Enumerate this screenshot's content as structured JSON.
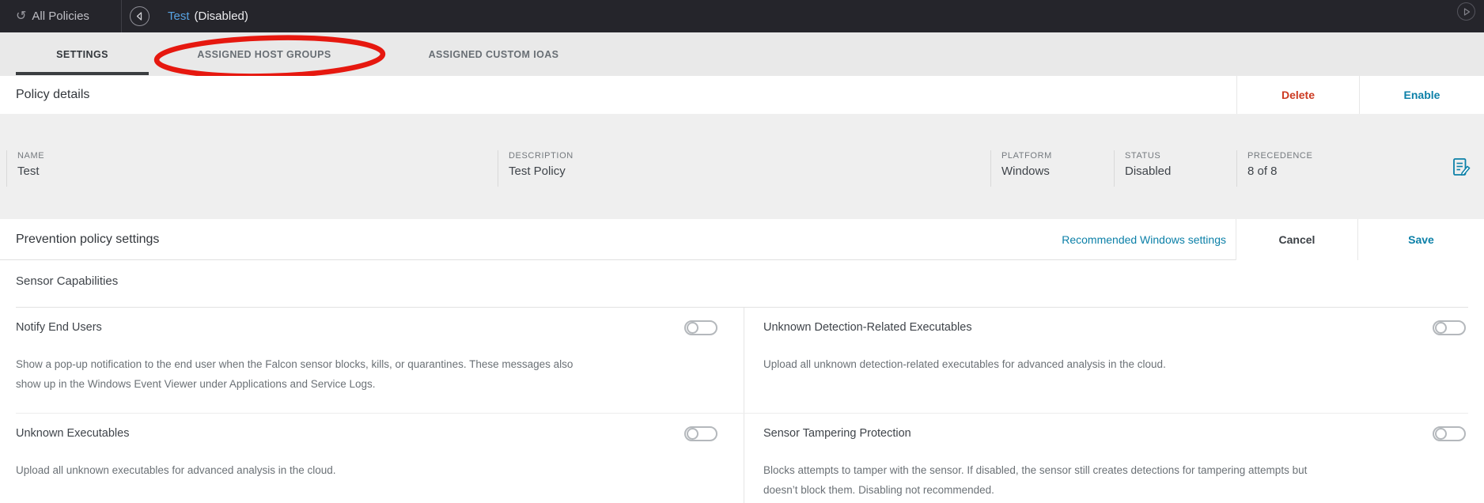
{
  "topbar": {
    "all_policies_label": "All Policies",
    "policy_name": "Test",
    "policy_state": "(Disabled)"
  },
  "tabs": [
    {
      "label": "SETTINGS",
      "active": true
    },
    {
      "label": "ASSIGNED HOST GROUPS",
      "active": false
    },
    {
      "label": "ASSIGNED CUSTOM IOAS",
      "active": false
    }
  ],
  "annotation": {
    "highlighted_tab": "ASSIGNED HOST GROUPS",
    "shape": "red-ellipse",
    "color": "#e6180f"
  },
  "policy_details": {
    "title": "Policy details",
    "delete_label": "Delete",
    "enable_label": "Enable",
    "fields": [
      {
        "label": "NAME",
        "value": "Test"
      },
      {
        "label": "DESCRIPTION",
        "value": "Test Policy"
      },
      {
        "label": "PLATFORM",
        "value": "Windows"
      },
      {
        "label": "STATUS",
        "value": "Disabled"
      },
      {
        "label": "PRECEDENCE",
        "value": "8 of 8"
      }
    ]
  },
  "prevention": {
    "title": "Prevention policy settings",
    "recommended_link": "Recommended Windows settings",
    "cancel_label": "Cancel",
    "save_label": "Save"
  },
  "sensor_capabilities": {
    "title": "Sensor Capabilities",
    "settings": [
      {
        "name": "Notify End Users",
        "description": "Show a pop-up notification to the end user when the Falcon sensor blocks, kills, or quarantines. These messages also show up in the Windows Event Viewer under Applications and Service Logs.",
        "enabled": false
      },
      {
        "name": "Unknown Detection-Related Executables",
        "description": "Upload all unknown detection-related executables for advanced analysis in the cloud.",
        "enabled": false
      },
      {
        "name": "Unknown Executables",
        "description": "Upload all unknown executables for advanced analysis in the cloud.",
        "enabled": false
      },
      {
        "name": "Sensor Tampering Protection",
        "description": "Blocks attempts to tamper with the sensor. If disabled, the sensor still creates detections for tampering attempts but doesn’t block them. Disabling not recommended.",
        "enabled": false
      }
    ]
  },
  "icons": {
    "breadcrumb_icon": "return-arrow",
    "back_icon": "circled-left-chevron",
    "expand_icon": "circled-play",
    "precedence_icon": "edit-list"
  },
  "colors": {
    "topbar_bg": "#25252b",
    "policy_name_blue": "#57a3e3",
    "delete_red": "#cc3a21",
    "accent_blue": "#0c80a8",
    "annotation_red": "#e6180f",
    "details_bg": "#efefef"
  }
}
